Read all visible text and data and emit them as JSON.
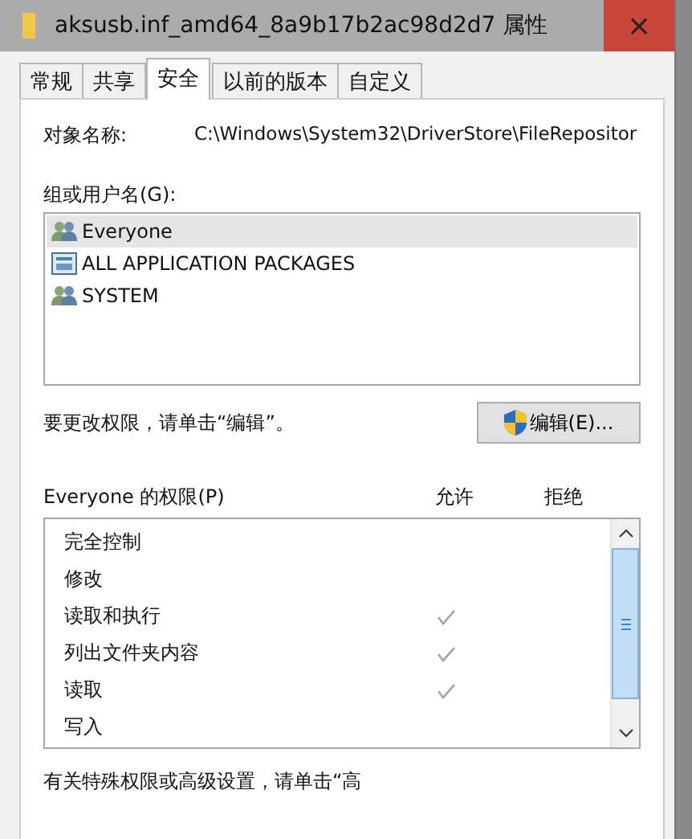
{
  "window": {
    "title": "aksusb.inf_amd64_8a9b17b2ac98d2d7 属性",
    "close": "×"
  },
  "tabs": [
    {
      "label": "常规",
      "selected": false
    },
    {
      "label": "共享",
      "selected": false
    },
    {
      "label": "安全",
      "selected": true
    },
    {
      "label": "以前的版本",
      "selected": false
    },
    {
      "label": "自定义",
      "selected": false
    }
  ],
  "object": {
    "label": "对象名称:",
    "value": "C:\\Windows\\System32\\DriverStore\\FileRepositor"
  },
  "users": {
    "label": "组或用户名(G):",
    "items": [
      {
        "name": "Everyone",
        "kind": "group",
        "selected": true
      },
      {
        "name": "ALL APPLICATION PACKAGES",
        "kind": "package",
        "selected": false
      },
      {
        "name": "SYSTEM",
        "kind": "group",
        "selected": false
      }
    ]
  },
  "edit_hint": "要更改权限，请单击“编辑”。",
  "edit_button": "编辑(E)...",
  "permissions": {
    "label": "Everyone 的权限(P)",
    "allow_label": "允许",
    "deny_label": "拒绝",
    "rows": [
      {
        "name": "完全控制",
        "allow": false,
        "deny": false
      },
      {
        "name": "修改",
        "allow": false,
        "deny": false
      },
      {
        "name": "读取和执行",
        "allow": true,
        "deny": false
      },
      {
        "name": "列出文件夹内容",
        "allow": true,
        "deny": false
      },
      {
        "name": "读取",
        "allow": true,
        "deny": false
      },
      {
        "name": "写入",
        "allow": false,
        "deny": false
      }
    ]
  },
  "advanced_hint": "有关特殊权限或高级设置，请单击“高"
}
